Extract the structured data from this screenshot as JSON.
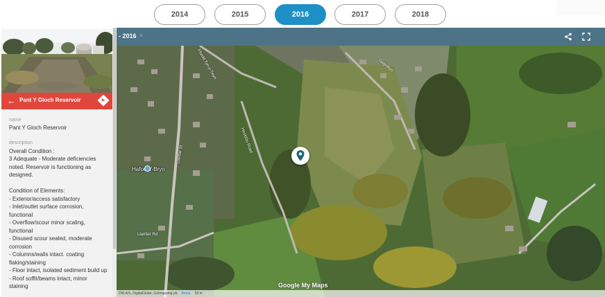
{
  "years": {
    "tabs": [
      "2014",
      "2015",
      "2016",
      "2017",
      "2018"
    ],
    "active": "2016"
  },
  "sidebar": {
    "header_title": "Pant Y Gloch Reservoir",
    "name_label": "name",
    "name_value": "Pant Y Gloch Reservoir",
    "description_label": "description",
    "description_lines": [
      "Overall Condition :",
      "3 Adequate - Moderate deficiencies",
      "noted. Reservoir is functioning as",
      "designed.",
      "",
      "Condition of Elements:",
      "- Exterior/access satisfactory",
      "- Inlet/outlet surface corrosion,",
      "functional",
      "- Overflow/scour minor scaling,",
      "functional",
      "- Disused scour sealed, moderate",
      "corrosion",
      "- Columns/walls intact. coating",
      "flaking/staining",
      "- Floor intact, isolated sediment build up",
      "- Roof soffit/beams intact, minor",
      "staining"
    ]
  },
  "map": {
    "title": "- 2016",
    "title_close": "×",
    "place_label": "Hafod-Y-Bryn",
    "logo_text": "Google My Maps",
    "attribution": "DW.A/S, DigitalGlobe, Getmapping plc",
    "terms": "Terms",
    "scale": "50 m",
    "streets": [
      "Ffordd Tyn-y-Twyn",
      "Heolddu Road",
      "Llanfair St",
      "Llanfair Rd",
      "Gwynfryn"
    ]
  },
  "colors": {
    "accent": "#1e90c6",
    "header_red": "#e0463c",
    "map_bar": "#4d7386",
    "marker": "#1f6673"
  },
  "icons": {
    "back": "arrow-left-icon",
    "directions": "directions-icon",
    "share": "share-icon",
    "fullscreen": "fullscreen-icon",
    "marker": "map-pin-icon"
  }
}
